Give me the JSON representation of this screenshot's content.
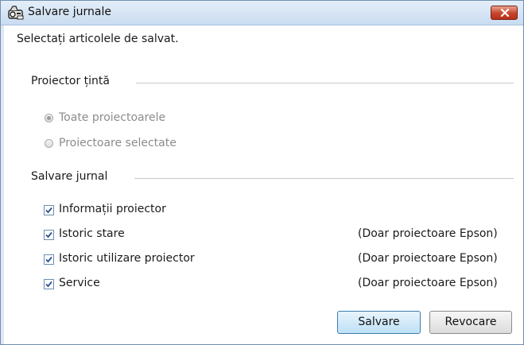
{
  "window": {
    "title": "Salvare jurnale",
    "icon": "projector-log-icon",
    "close_icon": "close-icon"
  },
  "instruction": "Selectați articolele de salvat.",
  "target_group": {
    "label": "Proiector țintă",
    "options": [
      {
        "label": "Toate proiectoarele",
        "selected": true,
        "enabled": false
      },
      {
        "label": "Proiectoare selectate",
        "selected": false,
        "enabled": false
      }
    ]
  },
  "save_group": {
    "label": "Salvare jurnal",
    "items": [
      {
        "label": "Informații proiector",
        "checked": true,
        "note": ""
      },
      {
        "label": "Istoric stare",
        "checked": true,
        "note": "(Doar proiectoare Epson)"
      },
      {
        "label": "Istoric utilizare proiector",
        "checked": true,
        "note": "(Doar proiectoare Epson)"
      },
      {
        "label": "Service",
        "checked": true,
        "note": "(Doar proiectoare Epson)"
      }
    ]
  },
  "buttons": {
    "save": "Salvare",
    "cancel": "Revocare"
  },
  "colors": {
    "checkmark": "#2a4f8f",
    "default_button_border": "#3c7fb1"
  }
}
